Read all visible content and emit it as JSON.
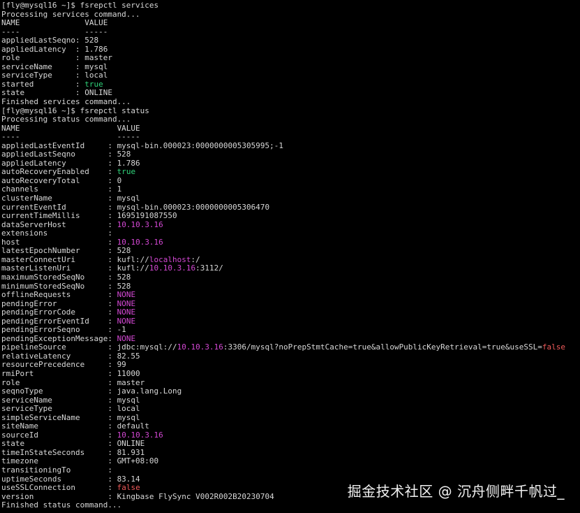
{
  "colors": {
    "background": "#000000",
    "text": "#d8d8d8",
    "green": "#2fd47a",
    "magenta": "#d448d4",
    "red": "#f05a5a"
  },
  "terminal": {
    "lines": [
      [
        {
          "t": "[fly@mysql16 ~]$ fsrepctl services"
        }
      ],
      [
        {
          "t": "Processing services command..."
        }
      ],
      [
        {
          "t": "NAME              VALUE"
        }
      ],
      [
        {
          "t": "----              -----"
        }
      ],
      [
        {
          "t": "appliedLastSeqno: 528"
        }
      ],
      [
        {
          "t": "appliedLatency  : 1.786"
        }
      ],
      [
        {
          "t": "role            : master"
        }
      ],
      [
        {
          "t": "serviceName     : mysql"
        }
      ],
      [
        {
          "t": "serviceType     : local"
        }
      ],
      [
        {
          "t": "started         : "
        },
        {
          "t": "true",
          "c": "green"
        }
      ],
      [
        {
          "t": "state           : ONLINE"
        }
      ],
      [
        {
          "t": "Finished services command..."
        }
      ],
      [
        {
          "t": "[fly@mysql16 ~]$ fsrepctl status"
        }
      ],
      [
        {
          "t": "Processing status command..."
        }
      ],
      [
        {
          "t": "NAME                     VALUE"
        }
      ],
      [
        {
          "t": "----                     -----"
        }
      ],
      [
        {
          "t": "appliedLastEventId     : mysql-bin.000023:0000000005305995;-1"
        }
      ],
      [
        {
          "t": "appliedLastSeqno       : 528"
        }
      ],
      [
        {
          "t": "appliedLatency         : 1.786"
        }
      ],
      [
        {
          "t": "autoRecoveryEnabled    : "
        },
        {
          "t": "true",
          "c": "green"
        }
      ],
      [
        {
          "t": "autoRecoveryTotal      : 0"
        }
      ],
      [
        {
          "t": "channels               : 1"
        }
      ],
      [
        {
          "t": "clusterName            : mysql"
        }
      ],
      [
        {
          "t": "currentEventId         : mysql-bin.000023:0000000005306470"
        }
      ],
      [
        {
          "t": "currentTimeMillis      : 1695191087550"
        }
      ],
      [
        {
          "t": "dataServerHost         : "
        },
        {
          "t": "10.10.3.16",
          "c": "magenta"
        }
      ],
      [
        {
          "t": "extensions             : "
        }
      ],
      [
        {
          "t": "host                   : "
        },
        {
          "t": "10.10.3.16",
          "c": "magenta"
        }
      ],
      [
        {
          "t": "latestEpochNumber      : 528"
        }
      ],
      [
        {
          "t": "masterConnectUri       : kufl://"
        },
        {
          "t": "localhost",
          "c": "magenta"
        },
        {
          "t": ":/"
        }
      ],
      [
        {
          "t": "masterListenUri        : kufl://"
        },
        {
          "t": "10.10.3.16",
          "c": "magenta"
        },
        {
          "t": ":3112/"
        }
      ],
      [
        {
          "t": "maximumStoredSeqNo     : 528"
        }
      ],
      [
        {
          "t": "minimumStoredSeqNo     : 528"
        }
      ],
      [
        {
          "t": "offlineRequests        : "
        },
        {
          "t": "NONE",
          "c": "magenta"
        }
      ],
      [
        {
          "t": "pendingError           : "
        },
        {
          "t": "NONE",
          "c": "magenta"
        }
      ],
      [
        {
          "t": "pendingErrorCode       : "
        },
        {
          "t": "NONE",
          "c": "magenta"
        }
      ],
      [
        {
          "t": "pendingErrorEventId    : "
        },
        {
          "t": "NONE",
          "c": "magenta"
        }
      ],
      [
        {
          "t": "pendingErrorSeqno      : -1"
        }
      ],
      [
        {
          "t": "pendingExceptionMessage: "
        },
        {
          "t": "NONE",
          "c": "magenta"
        }
      ],
      [
        {
          "t": "pipelineSource         : jdbc:mysql://"
        },
        {
          "t": "10.10.3.16",
          "c": "magenta"
        },
        {
          "t": ":3306/mysql?noPrepStmtCache=true&allowPublicKeyRetrieval=true&useSSL="
        },
        {
          "t": "false",
          "c": "red"
        }
      ],
      [
        {
          "t": "relativeLatency        : 82.55"
        }
      ],
      [
        {
          "t": "resourcePrecedence     : 99"
        }
      ],
      [
        {
          "t": "rmiPort                : 11000"
        }
      ],
      [
        {
          "t": "role                   : master"
        }
      ],
      [
        {
          "t": "seqnoType              : java.lang.Long"
        }
      ],
      [
        {
          "t": "serviceName            : mysql"
        }
      ],
      [
        {
          "t": "serviceType            : local"
        }
      ],
      [
        {
          "t": "simpleServiceName      : mysql"
        }
      ],
      [
        {
          "t": "siteName               : default"
        }
      ],
      [
        {
          "t": "sourceId               : "
        },
        {
          "t": "10.10.3.16",
          "c": "magenta"
        }
      ],
      [
        {
          "t": "state                  : ONLINE"
        }
      ],
      [
        {
          "t": "timeInStateSeconds     : 81.931"
        }
      ],
      [
        {
          "t": "timezone               : GMT+08:00"
        }
      ],
      [
        {
          "t": "transitioningTo        : "
        }
      ],
      [
        {
          "t": "uptimeSeconds          : 83.14"
        }
      ],
      [
        {
          "t": "useSSLConnection       : "
        },
        {
          "t": "false",
          "c": "red"
        }
      ],
      [
        {
          "t": "version                : Kingbase FlySync V002R002B20230704"
        }
      ],
      [
        {
          "t": "Finished status command..."
        }
      ]
    ]
  },
  "watermark": {
    "text": "掘金技术社区 @ 沉舟侧畔千帆过_"
  }
}
